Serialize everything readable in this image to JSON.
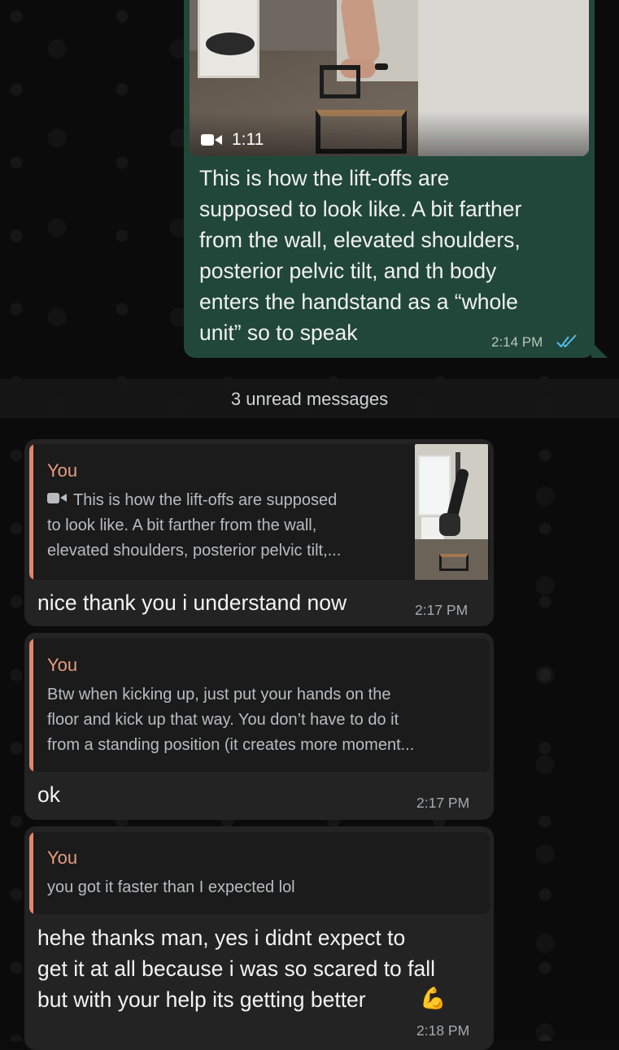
{
  "outgoing_message": {
    "video_duration": "1:11",
    "video_icon": "video-camera-icon",
    "text": "This is how the lift-offs are\nsupposed to look like. A bit farther\nfrom the wall, elevated shoulders,\nposterior pelvic tilt, and th body\nenters the handstand as a “whole\nunit” so to speak",
    "time": "2:14 PM",
    "status_icon": "double-check-read-icon",
    "status_color": "#53bdeb"
  },
  "unread_divider": "3 unread messages",
  "messages": [
    {
      "quote_author": "You",
      "quote_icon": "video-camera-icon",
      "quote_text": "This is how the lift-offs are supposed\nto look like. A bit farther from the wall,\nelevated shoulders, posterior pelvic tilt,...",
      "text": "nice thank you i understand now",
      "time": "2:17 PM"
    },
    {
      "quote_author": "You",
      "quote_text": "Btw when kicking up, just put your hands on the\nfloor and kick up that way. You don’t have to do it\nfrom a standing position (it creates more moment...",
      "text": "ok",
      "time": "2:17 PM"
    },
    {
      "quote_author": "You",
      "quote_text": "you got it faster than I expected lol",
      "text": "hehe thanks man, yes i didnt expect to\nget it at all because i was so scared to fall\nbut with your help its getting better",
      "emoji": "💪",
      "time": "2:18 PM"
    }
  ],
  "colors": {
    "outgoing_bubble": "#21473a",
    "incoming_bubble": "#232323",
    "quote_accent": "#e0876a"
  }
}
